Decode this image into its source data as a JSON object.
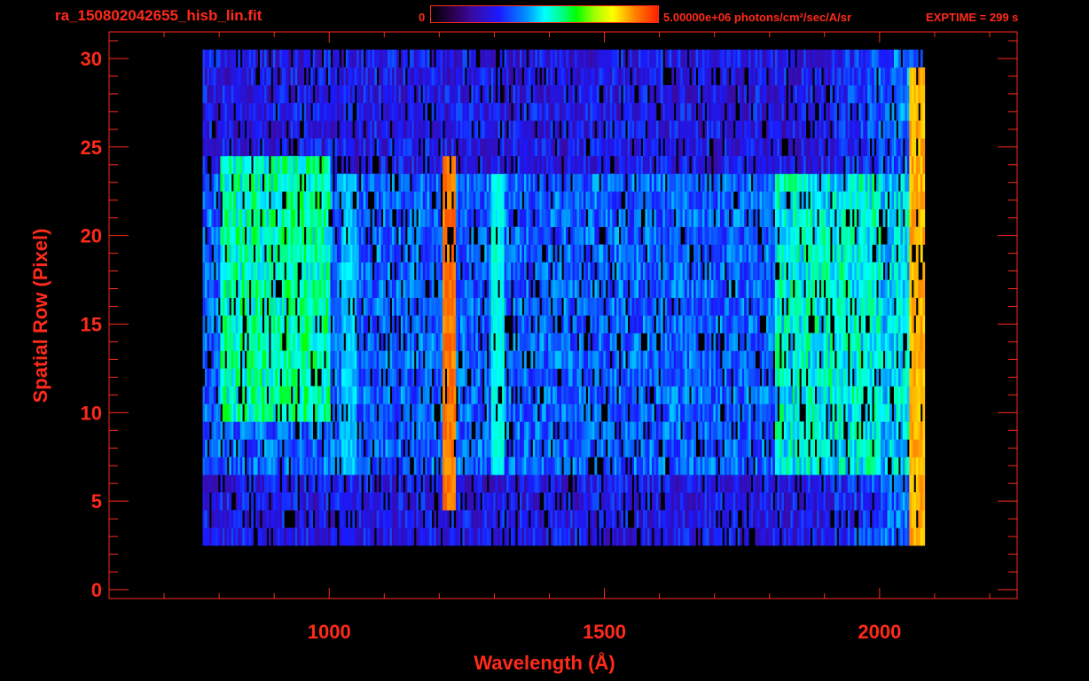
{
  "header": {
    "title": "ra_150802042655_hisb_lin.fit",
    "colorbar_min": "0",
    "colorbar_max_label": "5.00000e+06 photons/cm²/sec/A/sr",
    "exptime": "EXPTIME = 299 s"
  },
  "colors": {
    "axis": "#ff2a1a",
    "background": "#000000"
  },
  "chart_data": {
    "type": "heatmap",
    "title": "ra_150802042655_hisb_lin.fit",
    "xlabel": "Wavelength (Å)",
    "ylabel": "Spatial Row (Pixel)",
    "xlim": [
      600,
      2250
    ],
    "ylim": [
      -0.5,
      31.5
    ],
    "x_ticks": [
      1000,
      1500,
      2000
    ],
    "y_ticks": [
      0,
      5,
      10,
      15,
      20,
      25,
      30
    ],
    "colorbar": {
      "min": 0,
      "max": 5000000,
      "unit": "photons/cm²/sec/A/sr"
    },
    "data_extent": {
      "x_min": 770,
      "x_max": 2080,
      "y_min": 3,
      "y_max": 30
    },
    "features": [
      {
        "label": "bright vertical emission line",
        "x": 1216,
        "y_range": [
          5,
          24
        ],
        "level": 0.95
      },
      {
        "label": "arc-shaped extended emission",
        "x_range": [
          800,
          1000
        ],
        "y_range": [
          10,
          24
        ],
        "level": 0.6
      },
      {
        "label": "line",
        "x": 1304,
        "y_range": [
          7,
          23
        ],
        "level": 0.55
      },
      {
        "label": "line",
        "x": 1035,
        "y_range": [
          7,
          23
        ],
        "level": 0.5
      },
      {
        "label": "band",
        "x_range": [
          1810,
          2000
        ],
        "y_range": [
          7,
          23
        ],
        "level": 0.55
      },
      {
        "label": "detector edge",
        "x": 2065,
        "y_range": [
          1,
          29
        ],
        "level": 0.9
      }
    ]
  }
}
